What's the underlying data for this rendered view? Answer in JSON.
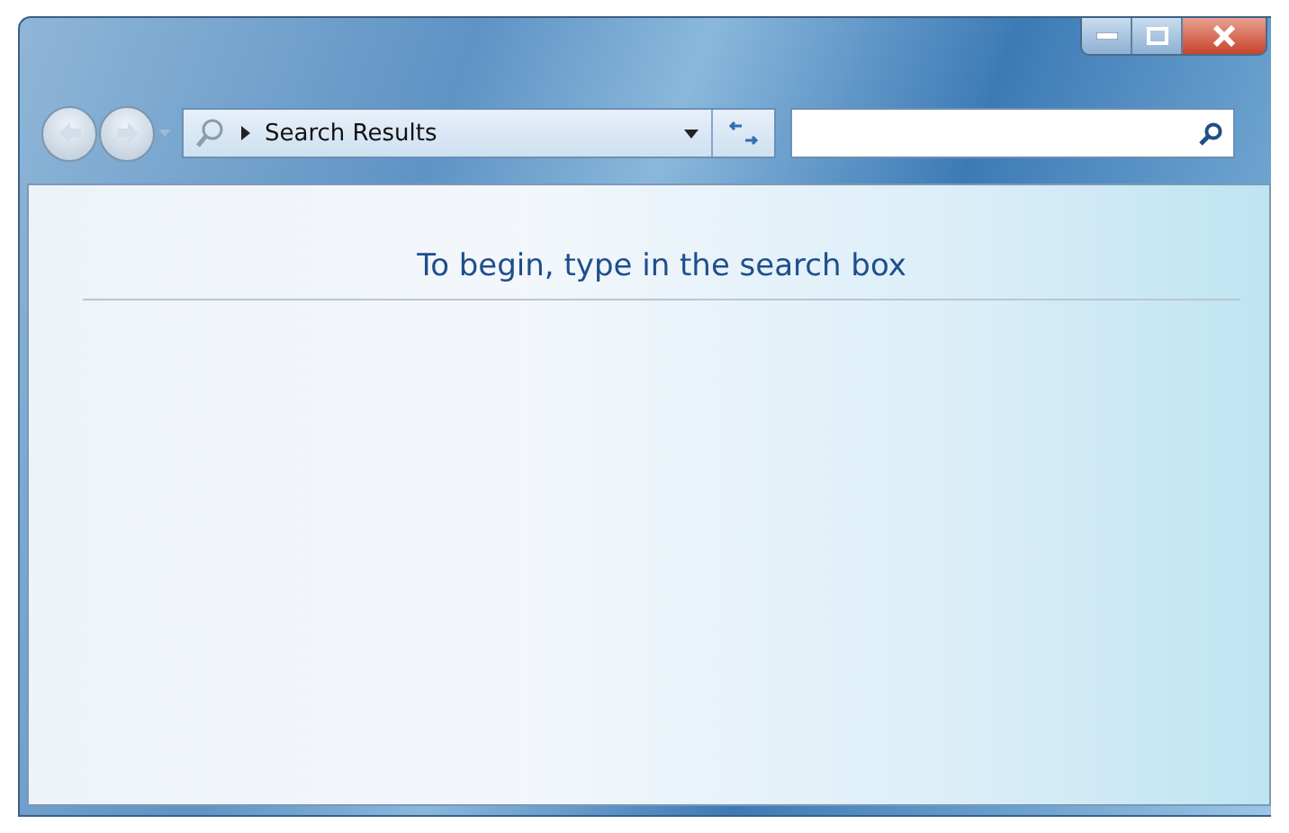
{
  "navigation": {
    "back": {
      "disabled": true
    },
    "forward": {
      "disabled": true
    }
  },
  "address_bar": {
    "location": "Search Results"
  },
  "content": {
    "message": "To begin, type in the search box"
  }
}
